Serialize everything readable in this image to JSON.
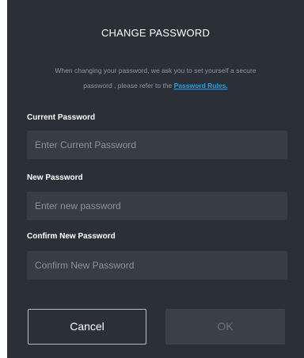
{
  "dialog": {
    "title": "CHANGE PASSWORD",
    "description_line1": "When changing your password, we ask you to set yourself a secure",
    "description_line2": "password , please refer to the",
    "rules_link": "Password Rules."
  },
  "fields": {
    "current": {
      "label": "Current Password",
      "placeholder": "Enter Current Password"
    },
    "new": {
      "label": "New Password",
      "placeholder": "Enter new password"
    },
    "confirm": {
      "label": "Confirm New Password",
      "placeholder": "Confirm New Password"
    }
  },
  "buttons": {
    "cancel": "Cancel",
    "ok": "OK"
  },
  "colors": {
    "dialog_bg": "#2b3038",
    "field_bg": "#373d46",
    "link": "#1fa6e6"
  }
}
